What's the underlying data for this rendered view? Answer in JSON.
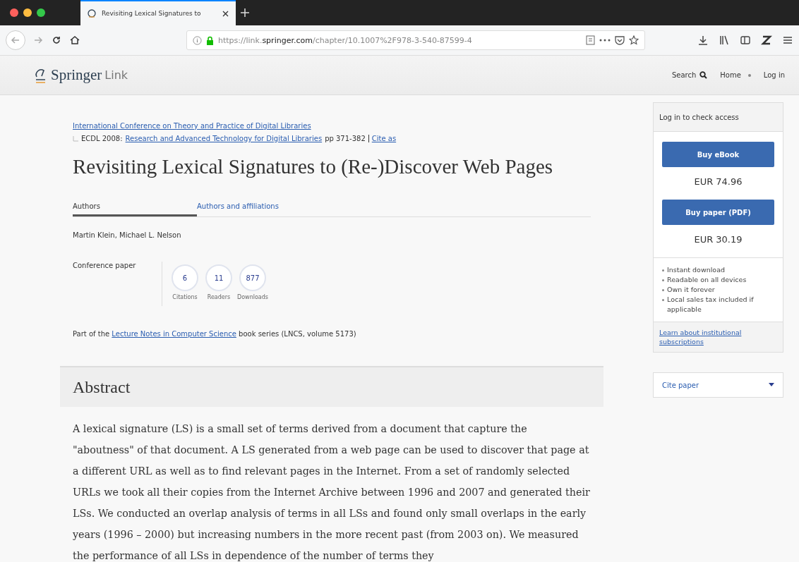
{
  "browser": {
    "tabs": [
      {
        "title": "Revisiting Lexical Signatures to",
        "selected": true
      }
    ],
    "url_prefix": "https://link.",
    "url_domain": "springer.com",
    "url_rest": "/chapter/10.1007%2F978-3-540-87599-4"
  },
  "site_header": {
    "logo_main": "Springer",
    "logo_sub": "Link",
    "nav": [
      {
        "label": "Search",
        "kind": "search"
      },
      {
        "label": "Home",
        "kind": "link"
      },
      {
        "label": "Log in",
        "kind": "link"
      }
    ]
  },
  "article": {
    "conference": "International Conference on Theory and Practice of Digital Libraries",
    "book_prefix": "ECDL 2008:",
    "book_title": "Research and Advanced Technology for Digital Libraries",
    "pages": "pp 371-382",
    "cite_link": "Cite as",
    "title": "Revisiting Lexical Signatures to (Re-)Discover Web Pages",
    "tabs": [
      {
        "label": "Authors",
        "selected": true
      },
      {
        "label": "Authors and affiliations",
        "selected": false
      }
    ],
    "authors": "Martin Klein, Michael L. Nelson",
    "type": "Conference paper",
    "metrics": [
      {
        "value": "6",
        "label": "Citations"
      },
      {
        "value": "11",
        "label": "Readers"
      },
      {
        "value": "877",
        "label": "Downloads"
      }
    ],
    "series_prefix": "Part of the",
    "series_link": "Lecture Notes in Computer Science",
    "series_suffix": "book series (LNCS, volume 5173)",
    "abstract_heading": "Abstract",
    "abstract": "A lexical signature (LS) is a small set of terms derived from a document that capture the \"aboutness\" of that document. A LS generated from a web page can be used to discover that page at a different URL as well as to find relevant pages in the Internet. From a set of randomly selected URLs we took all their copies from the Internet Archive between 1996 and 2007 and generated their LSs. We conducted an overlap analysis of terms in all LSs and found only small overlaps in the early years (1996 – 2000) but increasing numbers in the more recent past (from 2003 on). We measured the performance of all LSs in dependence of the number of terms they"
  },
  "sidebar": {
    "access": "Log in to check access",
    "offers": [
      {
        "button": "Buy eBook",
        "price": "EUR 74.96"
      },
      {
        "button": "Buy paper (PDF)",
        "price": "EUR 30.19"
      }
    ],
    "benefits": [
      "Instant download",
      "Readable on all devices",
      "Own it forever",
      "Local sales tax included if applicable"
    ],
    "institutional_link": "Learn about institutional subscriptions",
    "cite_dropdown": "Cite paper"
  }
}
